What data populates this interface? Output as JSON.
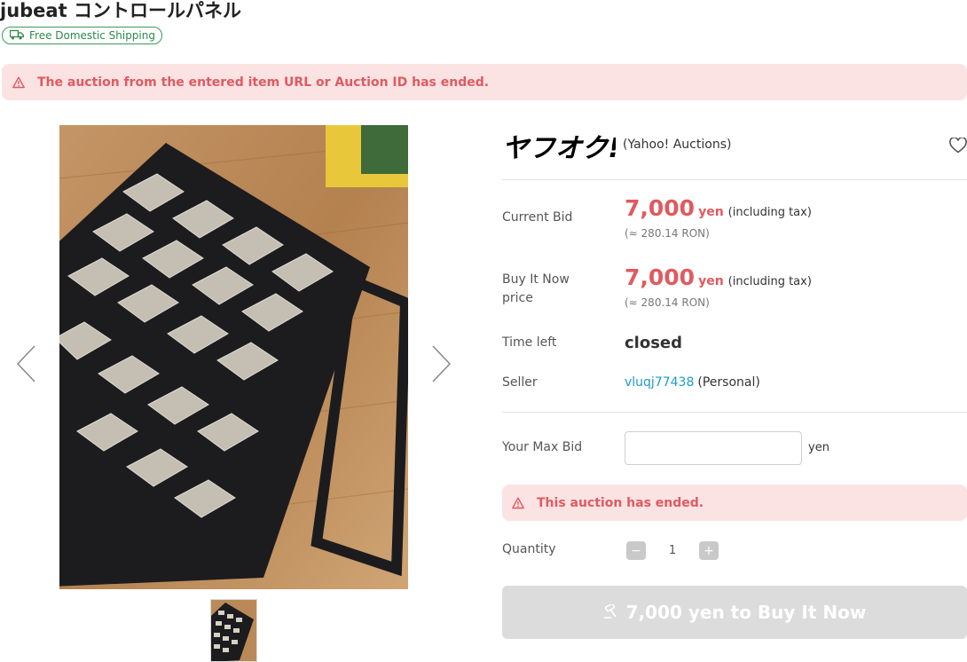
{
  "page": {
    "title": "jubeat コントロールパネル",
    "shipping_badge": "Free Domestic Shipping"
  },
  "alerts": {
    "top": "The auction from the entered item URL or Auction ID has ended.",
    "ended": "This auction has ended."
  },
  "brand": {
    "logo_text": "ヤフオク!",
    "subtitle": "(Yahoo! Auctions)"
  },
  "current_bid": {
    "label": "Current Bid",
    "amount": "7,000",
    "unit": "yen",
    "tax_note": "(including tax)",
    "conversion": "(≈ 280.14 RON)"
  },
  "buy_now": {
    "label": "Buy It Now price",
    "amount": "7,000",
    "unit": "yen",
    "tax_note": "(including tax)",
    "conversion": "(≈ 280.14 RON)"
  },
  "time_left": {
    "label": "Time left",
    "value": "closed"
  },
  "seller": {
    "label": "Seller",
    "name": "vluqj77438",
    "type": "(Personal)"
  },
  "max_bid": {
    "label": "Your Max Bid",
    "value": "",
    "unit": "yen"
  },
  "quantity": {
    "label": "Quantity",
    "minus": "−",
    "value": "1",
    "plus": "+"
  },
  "buy_button": {
    "label": "7,000 yen to Buy It Now"
  },
  "colors": {
    "accent_red": "#e05a5f",
    "alert_bg": "#fbe3e4",
    "shipping_green": "#2d8a4b",
    "link_blue": "#1a9ccf",
    "disabled_button": "#dcdcdc"
  },
  "icons": {
    "shipping": "truck-icon",
    "alert": "warning-triangle-icon",
    "favorite": "heart-icon",
    "prev": "chevron-left-icon",
    "next": "chevron-right-icon",
    "buy": "gavel-icon"
  }
}
